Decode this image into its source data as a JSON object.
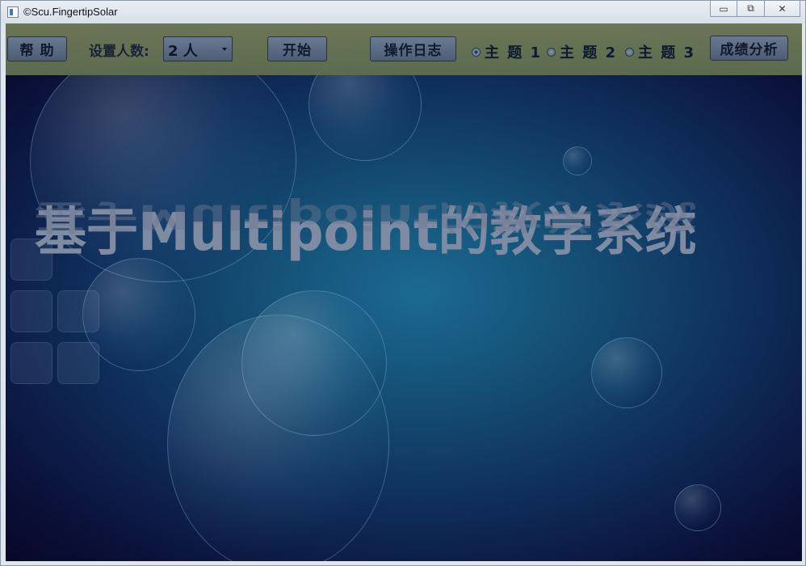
{
  "window": {
    "title": "©Scu.FingertipSolar",
    "controls": {
      "minimize": "▭",
      "restore": "⧉",
      "close": "✕"
    }
  },
  "toolbar": {
    "help_label": "帮 助",
    "players_label": "设置人数:",
    "players_value": "2 人",
    "start_label": "开始",
    "log_label": "操作日志",
    "themes": [
      {
        "label": "主 题 1",
        "selected": true
      },
      {
        "label": "主 题 2",
        "selected": false
      },
      {
        "label": "主 题 3",
        "selected": false
      }
    ],
    "analysis_label": "成绩分析"
  },
  "main": {
    "hero_title": "基于Multipoint的教学系统"
  },
  "colors": {
    "background_center": "#1b6a93",
    "background_edge": "#08072a",
    "toolbar": "#66734f",
    "button": "#5a6a84"
  }
}
